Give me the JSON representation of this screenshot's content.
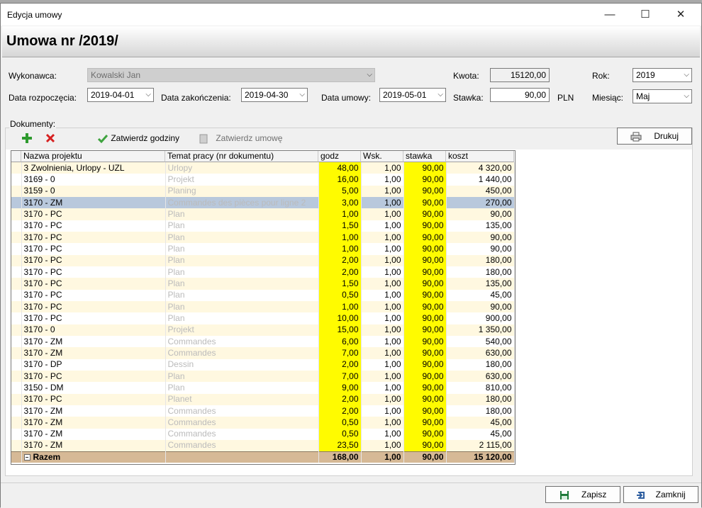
{
  "window": {
    "title": "Edycja umowy",
    "minimize": "—",
    "maximize": "☐",
    "close": "✕"
  },
  "header": {
    "title": "Umowa nr /2019/"
  },
  "form": {
    "contractor_label": "Wykonawca:",
    "contractor_value": "Kowalski Jan",
    "amount_label": "Kwota:",
    "amount_value": "15120,00",
    "year_label": "Rok:",
    "year_value": "2019",
    "start_label": "Data rozpoczęcia:",
    "start_value": "2019-04-01",
    "end_label": "Data zakończenia:",
    "end_value": "2019-04-30",
    "contract_date_label": "Data umowy:",
    "contract_date_value": "2019-05-01",
    "rate_label": "Stawka:",
    "rate_value": "90,00",
    "currency": "PLN",
    "month_label": "Miesiąc:",
    "month_value": "Maj"
  },
  "documents": {
    "legend": "Dokumenty:",
    "confirm_hours": "Zatwierdz godziny",
    "confirm_contract": "Zatwierdz umowę",
    "print": "Drukuj"
  },
  "grid": {
    "columns": [
      "Nazwa projektu",
      "Temat pracy (nr dokumentu)",
      "godz",
      "Wsk.",
      "stawka",
      "koszt"
    ],
    "rows": [
      [
        "3 Zwolnienia, Urlopy - UZL",
        "Urlopy",
        "48,00",
        "1,00",
        "90,00",
        "4 320,00"
      ],
      [
        "3169 - 0",
        "Projekt",
        "16,00",
        "1,00",
        "90,00",
        "1 440,00"
      ],
      [
        "3159 - 0",
        "Planing",
        "5,00",
        "1,00",
        "90,00",
        "450,00"
      ],
      [
        "3170 - ZM",
        "Commandes des pièces pour ligne 2",
        "3,00",
        "1,00",
        "90,00",
        "270,00"
      ],
      [
        "3170 - PC",
        "Plan",
        "1,00",
        "1,00",
        "90,00",
        "90,00"
      ],
      [
        "3170 - PC",
        "Plan",
        "1,50",
        "1,00",
        "90,00",
        "135,00"
      ],
      [
        "3170 - PC",
        "Plan",
        "1,00",
        "1,00",
        "90,00",
        "90,00"
      ],
      [
        "3170 - PC",
        "Plan",
        "1,00",
        "1,00",
        "90,00",
        "90,00"
      ],
      [
        "3170 - PC",
        "Plan",
        "2,00",
        "1,00",
        "90,00",
        "180,00"
      ],
      [
        "3170 - PC",
        "Plan",
        "2,00",
        "1,00",
        "90,00",
        "180,00"
      ],
      [
        "3170 - PC",
        "Plan",
        "1,50",
        "1,00",
        "90,00",
        "135,00"
      ],
      [
        "3170 - PC",
        "Plan",
        "0,50",
        "1,00",
        "90,00",
        "45,00"
      ],
      [
        "3170 - PC",
        "Plan",
        "1,00",
        "1,00",
        "90,00",
        "90,00"
      ],
      [
        "3170 - PC",
        "Plan",
        "10,00",
        "1,00",
        "90,00",
        "900,00"
      ],
      [
        "3170 - 0",
        "Projekt",
        "15,00",
        "1,00",
        "90,00",
        "1 350,00"
      ],
      [
        "3170 - ZM",
        "Commandes",
        "6,00",
        "1,00",
        "90,00",
        "540,00"
      ],
      [
        "3170 - ZM",
        "Commandes",
        "7,00",
        "1,00",
        "90,00",
        "630,00"
      ],
      [
        "3170 - DP",
        "Dessin",
        "2,00",
        "1,00",
        "90,00",
        "180,00"
      ],
      [
        "3170 - PC",
        "Plan",
        "7,00",
        "1,00",
        "90,00",
        "630,00"
      ],
      [
        "3150 - DM",
        "Plan",
        "9,00",
        "1,00",
        "90,00",
        "810,00"
      ],
      [
        "3170 - PC",
        "Planet",
        "2,00",
        "1,00",
        "90,00",
        "180,00"
      ],
      [
        "3170 - ZM",
        "Commandes",
        "2,00",
        "1,00",
        "90,00",
        "180,00"
      ],
      [
        "3170 - ZM",
        "Commandes",
        "0,50",
        "1,00",
        "90,00",
        "45,00"
      ],
      [
        "3170 - ZM",
        "Commandes",
        "0,50",
        "1,00",
        "90,00",
        "45,00"
      ],
      [
        "3170 - ZM",
        "Commandes",
        "23,50",
        "1,00",
        "90,00",
        "2 115,00"
      ]
    ],
    "summary": {
      "label": "Razem",
      "hours": "168,00",
      "factor": "1,00",
      "rate": "90,00",
      "cost": "15 120,00"
    }
  },
  "footer": {
    "save": "Zapisz",
    "close": "Zamknij"
  },
  "colors": {
    "highlight": "#fffb00",
    "selected_row": "#b8c8dc",
    "summary_row": "#d6b996",
    "add_icon": "#2e9a2e",
    "delete_icon": "#d62020"
  }
}
